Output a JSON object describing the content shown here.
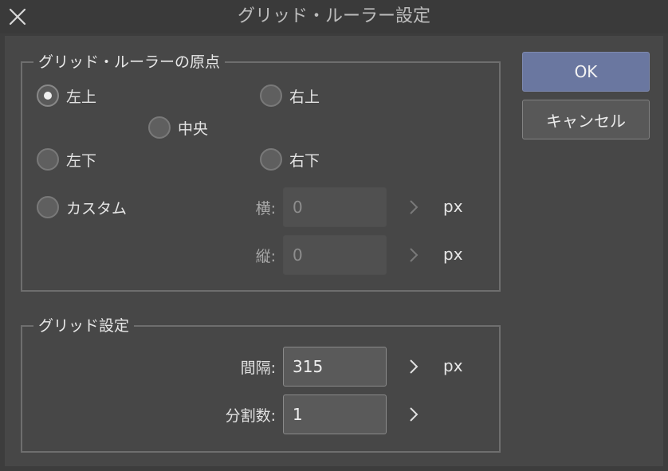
{
  "window": {
    "title": "グリッド・ルーラー設定",
    "close_icon": "close-icon"
  },
  "origin_group": {
    "legend": "グリッド・ルーラーの原点",
    "options": [
      {
        "label": "左上",
        "checked": true
      },
      {
        "label": "右上",
        "checked": false
      },
      {
        "label": "中央",
        "checked": false
      },
      {
        "label": "左下",
        "checked": false
      },
      {
        "label": "右下",
        "checked": false
      },
      {
        "label": "カスタム",
        "checked": false
      }
    ],
    "horizontal": {
      "label": "横:",
      "value": "0",
      "unit": "px",
      "enabled": false
    },
    "vertical": {
      "label": "縦:",
      "value": "0",
      "unit": "px",
      "enabled": false
    }
  },
  "grid_group": {
    "legend": "グリッド設定",
    "interval": {
      "label": "間隔:",
      "value": "315",
      "unit": "px"
    },
    "divisions": {
      "label": "分割数:",
      "value": "1"
    }
  },
  "buttons": {
    "ok": "OK",
    "cancel": "キャンセル"
  },
  "colors": {
    "ok_button": "#6a77a0",
    "dialog_background": "#474747"
  }
}
